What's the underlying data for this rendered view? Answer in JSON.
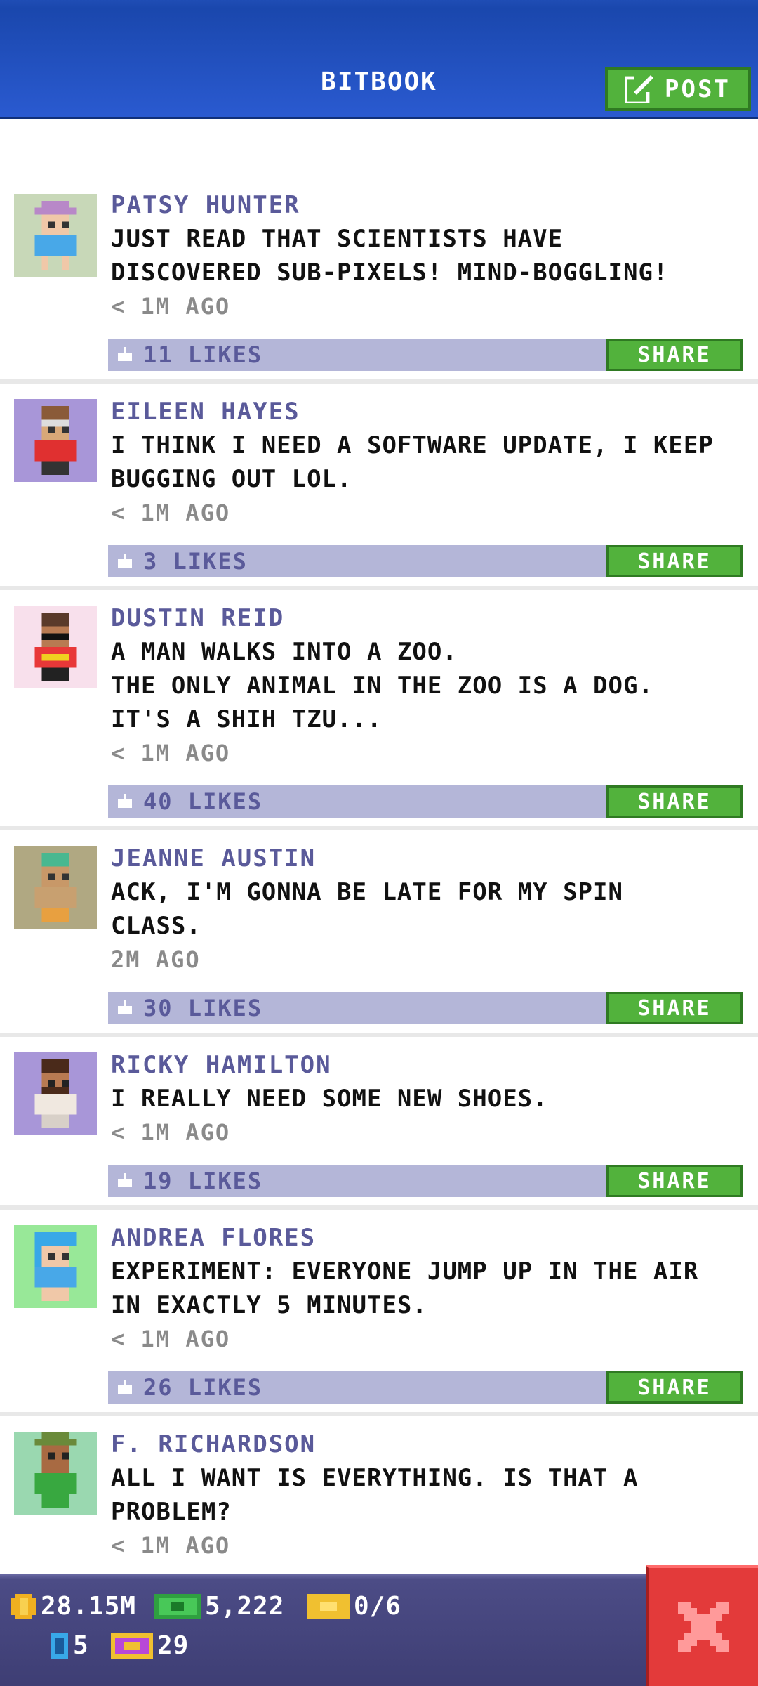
{
  "header": {
    "title": "BITBOOK",
    "post_label": "POST"
  },
  "posts": [
    {
      "name": "PATSY HUNTER",
      "text": "JUST READ THAT SCIENTISTS HAVE\nDISCOVERED SUB-PIXELS! MIND-BOGGLING!",
      "time": "< 1M AGO",
      "likes": "11 LIKES",
      "share": "SHARE",
      "avatar_bg": "#c8d8b8"
    },
    {
      "name": "EILEEN HAYES",
      "text": "I THINK I NEED A SOFTWARE UPDATE, I KEEP\nBUGGING OUT LOL.",
      "time": "< 1M AGO",
      "likes": "3 LIKES",
      "share": "SHARE",
      "avatar_bg": "#a896d8"
    },
    {
      "name": "DUSTIN REID",
      "text": "A MAN WALKS INTO A ZOO.\nTHE ONLY ANIMAL IN THE ZOO IS A DOG.\nIT'S A SHIH TZU...",
      "time": "< 1M AGO",
      "likes": "40 LIKES",
      "share": "SHARE",
      "avatar_bg": "#f8e0ec"
    },
    {
      "name": "JEANNE AUSTIN",
      "text": "ACK, I'M GONNA BE LATE FOR MY SPIN\nCLASS.",
      "time": "2M AGO",
      "likes": "30 LIKES",
      "share": "SHARE",
      "avatar_bg": "#b0a882"
    },
    {
      "name": "RICKY HAMILTON",
      "text": "I REALLY NEED SOME NEW SHOES.",
      "time": "< 1M AGO",
      "likes": "19 LIKES",
      "share": "SHARE",
      "avatar_bg": "#a896d8"
    },
    {
      "name": "ANDREA FLORES",
      "text": "EXPERIMENT: EVERYONE JUMP UP IN THE AIR\nIN EXACTLY 5 MINUTES.",
      "time": "< 1M AGO",
      "likes": "26 LIKES",
      "share": "SHARE",
      "avatar_bg": "#98e898"
    },
    {
      "name": "F. RICHARDSON",
      "text": "ALL I WANT IS EVERYTHING. IS THAT A\nPROBLEM?",
      "time": "< 1M AGO",
      "likes": "",
      "share": "",
      "avatar_bg": "#9ad8b0"
    }
  ],
  "status": {
    "coins": "28.15M",
    "bux": "5,222",
    "tickets": "0/6",
    "elevators": "5",
    "vip": "29"
  },
  "colors": {
    "header": "#2a5ad0",
    "share": "#52b23c",
    "likebar": "#b4b6d8",
    "close": "#e33a3a"
  }
}
